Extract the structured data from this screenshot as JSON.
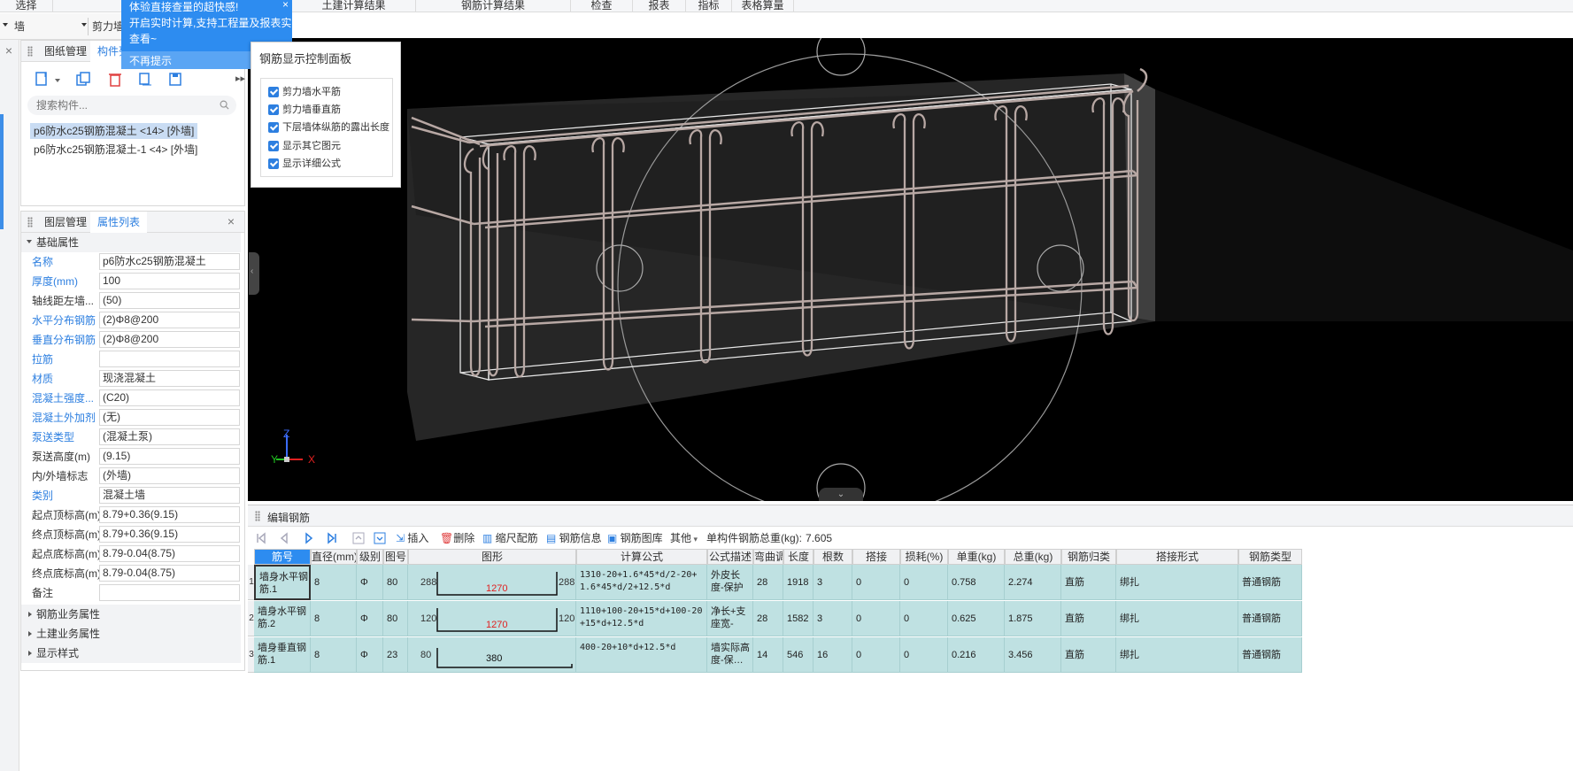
{
  "topbar": {
    "tabs": [
      {
        "label": "选择"
      },
      {
        "label": "土建计算结果"
      },
      {
        "label": "钢筋计算结果"
      },
      {
        "label": "检查"
      },
      {
        "label": "报表"
      },
      {
        "label": "指标"
      },
      {
        "label": "表格算量"
      }
    ]
  },
  "selectors": {
    "element_type": "墙",
    "element_subtype": "剪力墙"
  },
  "tooltip": {
    "line1": "体验直接查量的超快感!",
    "line2": "开启实时计算,支持工程量及报表实时",
    "line3": "查看~",
    "dismiss": "不再提示"
  },
  "top_panel": {
    "tabs": [
      "图纸管理",
      "构件列表"
    ],
    "search_placeholder": "搜索构件...",
    "components": [
      {
        "label": "p6防水c25钢筋混凝土 <14> [外墙]",
        "selected": true
      },
      {
        "label": "p6防水c25钢筋混凝土-1 <4> [外墙]",
        "selected": false
      }
    ]
  },
  "prop_panel": {
    "tabs": [
      "图层管理",
      "属性列表"
    ],
    "groups": {
      "basic": "基础属性",
      "rebar": "钢筋业务属性",
      "civil": "土建业务属性",
      "display": "显示样式"
    },
    "rows": [
      {
        "name": "名称",
        "value": "p6防水c25钢筋混凝土",
        "blue": true
      },
      {
        "name": "厚度(mm)",
        "value": "100",
        "blue": true
      },
      {
        "name": "轴线距左墙...",
        "value": "(50)",
        "blue": false
      },
      {
        "name": "水平分布钢筋",
        "value": "(2)Φ8@200",
        "blue": true
      },
      {
        "name": "垂直分布钢筋",
        "value": "(2)Φ8@200",
        "blue": true
      },
      {
        "name": "拉筋",
        "value": "",
        "blue": true
      },
      {
        "name": "材质",
        "value": "现浇混凝土",
        "blue": true
      },
      {
        "name": "混凝土强度...",
        "value": "(C20)",
        "blue": true
      },
      {
        "name": "混凝土外加剂",
        "value": "(无)",
        "blue": true
      },
      {
        "name": "泵送类型",
        "value": "(混凝土泵)",
        "blue": true
      },
      {
        "name": "泵送高度(m)",
        "value": "(9.15)",
        "blue": false
      },
      {
        "name": "内/外墙标志",
        "value": "(外墙)",
        "blue": false
      },
      {
        "name": "类别",
        "value": "混凝土墙",
        "blue": true
      },
      {
        "name": "起点顶标高(m)",
        "value": "8.79+0.36(9.15)",
        "blue": false
      },
      {
        "name": "终点顶标高(m)",
        "value": "8.79+0.36(9.15)",
        "blue": false
      },
      {
        "name": "起点底标高(m)",
        "value": "8.79-0.04(8.75)",
        "blue": false
      },
      {
        "name": "终点底标高(m)",
        "value": "8.79-0.04(8.75)",
        "blue": false
      },
      {
        "name": "备注",
        "value": "",
        "blue": false
      }
    ]
  },
  "control_panel": {
    "title": "钢筋显示控制面板",
    "options": [
      {
        "label": "剪力墙水平筋",
        "checked": true
      },
      {
        "label": "剪力墙垂直筋",
        "checked": true
      },
      {
        "label": "下层墙体纵筋的露出长度",
        "checked": true
      },
      {
        "label": "显示其它图元",
        "checked": true
      },
      {
        "label": "显示详细公式",
        "checked": true
      }
    ]
  },
  "axes": {
    "x": "X",
    "y": "Y",
    "z": "Z"
  },
  "edit_panel": {
    "title": "编辑钢筋",
    "tools": {
      "insert": "插入",
      "delete": "删除",
      "scale_rebar": "缩尺配筋",
      "rebar_info": "钢筋信息",
      "rebar_library": "钢筋图库",
      "other": "其他",
      "total_label": "单构件钢筋总重(kg):",
      "total_value": "7.605"
    },
    "columns": [
      "筋号",
      "直径(mm)",
      "级别",
      "图号",
      "图形",
      "计算公式",
      "公式描述",
      "弯曲调整",
      "长度",
      "根数",
      "搭接",
      "损耗(%)",
      "单重(kg)",
      "总重(kg)",
      "钢筋归类",
      "搭接形式",
      "钢筋类型"
    ],
    "rows": [
      {
        "num": "1",
        "name": "墙身水平钢筋.1",
        "diameter": "8",
        "grade": "Φ",
        "fig": "80",
        "shape_left": "288",
        "shape_mid": "1270",
        "shape_right": "288",
        "formula": "1310-20+1.6*45*d/2-20+1.6*45*d/2+12.5*d",
        "desc": "外皮长度-保护层…",
        "bend": "28",
        "length": "1918",
        "count": "3",
        "lap": "0",
        "loss": "0",
        "unit_wt": "0.758",
        "total_wt": "2.274",
        "category": "直筋",
        "lap_type": "绑扎",
        "rebar_type": "普通钢筋"
      },
      {
        "num": "2",
        "name": "墙身水平钢筋.2",
        "diameter": "8",
        "grade": "Φ",
        "fig": "80",
        "shape_left": "120",
        "shape_mid": "1270",
        "shape_right": "120",
        "formula": "1110+100-20+15*d+100-20+15*d+12.5*d",
        "desc": "净长+支座宽-保…",
        "bend": "28",
        "length": "1582",
        "count": "3",
        "lap": "0",
        "loss": "0",
        "unit_wt": "0.625",
        "total_wt": "1.875",
        "category": "直筋",
        "lap_type": "绑扎",
        "rebar_type": "普通钢筋"
      },
      {
        "num": "3",
        "name": "墙身垂直钢筋.1",
        "diameter": "8",
        "grade": "Φ",
        "fig": "23",
        "shape_left": "80",
        "shape_mid": "380",
        "shape_right": "",
        "formula": "400-20+10*d+12.5*d",
        "desc": "墙实际高度-保…",
        "bend": "14",
        "length": "546",
        "count": "16",
        "lap": "0",
        "loss": "0",
        "unit_wt": "0.216",
        "total_wt": "3.456",
        "category": "直筋",
        "lap_type": "绑扎",
        "rebar_type": "普通钢筋"
      }
    ]
  },
  "colors": {
    "accent": "#2d8cf0",
    "row_bg": "#bfe1e2",
    "rebar": "#b8a8a4",
    "shape_red": "#e02020"
  }
}
